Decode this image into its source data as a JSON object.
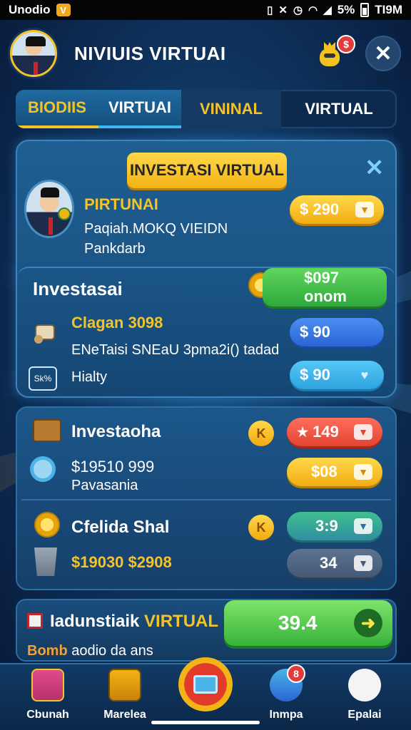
{
  "status_bar": {
    "carrier": "Unodio",
    "app_badge": "V",
    "battery": "5%",
    "time": "TI9M",
    "icons": [
      "nfc-icon",
      "mute-icon",
      "alarm-icon",
      "wifi-icon",
      "signal-icon",
      "battery-icon"
    ]
  },
  "header": {
    "title": "NIVIUIS VIRTUAI",
    "badge_symbol": "$",
    "close_symbol": "✕"
  },
  "tabs": [
    {
      "label": "BIODIIS"
    },
    {
      "label": "VIRTUAI"
    },
    {
      "label": "VININAL"
    },
    {
      "label": "VIRTUAL"
    }
  ],
  "panel": {
    "title": "INVESTASI VIRTUAL",
    "close_symbol": "✕",
    "profile": {
      "name": "PIRTUNAI",
      "line1": "Paqiah.MOKQ VIEIDN",
      "line2": "Pankdarb"
    },
    "buttons": {
      "top": {
        "label": "$ 290"
      },
      "green": {
        "label": "$097 onom"
      },
      "blue": {
        "label": "$ 90"
      },
      "sky": {
        "label": "$ 90"
      }
    },
    "invest_card": {
      "title": "Investasai",
      "row1_title": "Clagan 3098",
      "row1_sub": "ENeTaisi SNEaU 3pma2i() tadad",
      "row2_label": "Hialty",
      "row2_tag": "Sk%"
    }
  },
  "panel2": {
    "row1": {
      "title": "Investaoha",
      "k": "K",
      "button": "149"
    },
    "row2": {
      "amount": "$19510 999",
      "sub": "Pavasania",
      "button": "$08"
    },
    "row3": {
      "title": "Cfelida Shal",
      "k": "K",
      "button": "3:9"
    },
    "row4": {
      "amount": "$19030 $2908",
      "button": "34"
    }
  },
  "banner": {
    "title_prefix": "Iadunstiaik",
    "title_highlight": "VIRTUAL",
    "sub_bold": "Bomb",
    "sub_rest": "aodio da ans",
    "button_value": "39.4"
  },
  "nav": [
    {
      "label": "Cbunah",
      "icon": "gift-box-icon"
    },
    {
      "label": "Marelea",
      "icon": "treasure-chest-icon"
    },
    {
      "label": "",
      "icon": "tablet-icon"
    },
    {
      "label": "Inmpa",
      "icon": "gadget-icon",
      "badge": "8"
    },
    {
      "label": "Epalai",
      "icon": "mascot-icon"
    }
  ],
  "colors": {
    "accent_gold": "#f3c32b",
    "accent_green": "#37b33a",
    "accent_blue": "#2a64d4",
    "background": "#0f3560"
  }
}
